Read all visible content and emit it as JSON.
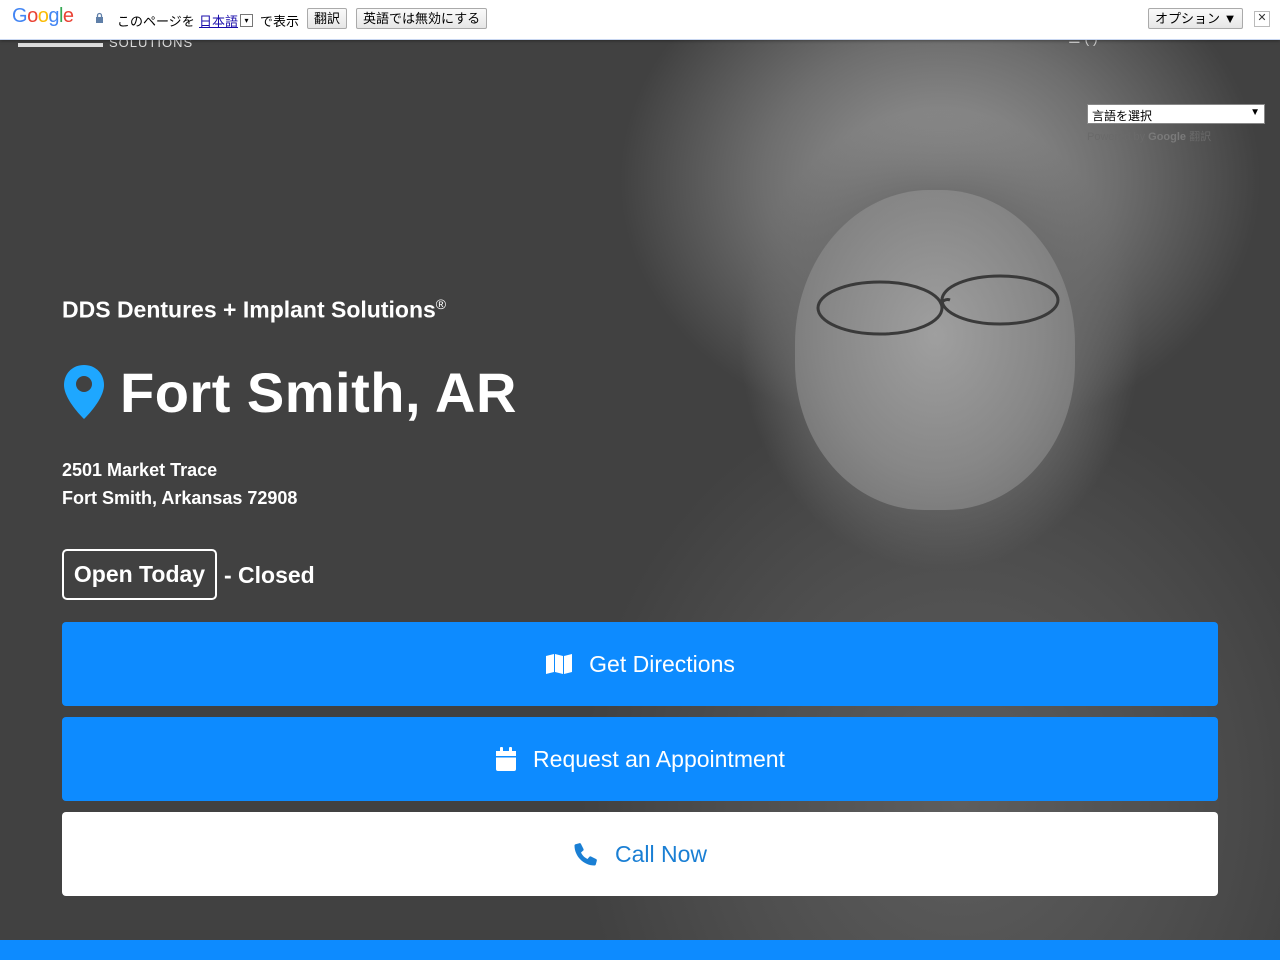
{
  "translate_bar": {
    "logo": [
      "G",
      "o",
      "o",
      "g",
      "l",
      "e"
    ],
    "prompt_before": "このページを",
    "language_link": "日本語",
    "dropdown_glyph": "▾",
    "prompt_after": "で表示",
    "translate_button": "翻訳",
    "disable_button": "英語では無効にする",
    "options_button": "オプション ▼",
    "close_glyph": "✕"
  },
  "site_header": {
    "logo_text": "SOLUTIONS",
    "menu_peek": "☰ (     )"
  },
  "language_widget": {
    "selected": "言語を選択",
    "arrow": "▼",
    "powered_by": "Powered by",
    "google": "Google",
    "translate": "翻訳"
  },
  "hero": {
    "brand": "DDS Dentures + Implant Solutions",
    "brand_mark": "®",
    "city": "Fort Smith, AR",
    "address_line1": "2501 Market Trace",
    "address_line2": "Fort Smith, Arkansas 72908",
    "open_label": "Open Today",
    "open_status": "- Closed"
  },
  "actions": {
    "directions": "Get Directions",
    "appointment": "Request an Appointment",
    "call": "Call Now"
  },
  "colors": {
    "accent": "#0d8bff",
    "background": "#414141",
    "pin": "#1ea7ff"
  }
}
